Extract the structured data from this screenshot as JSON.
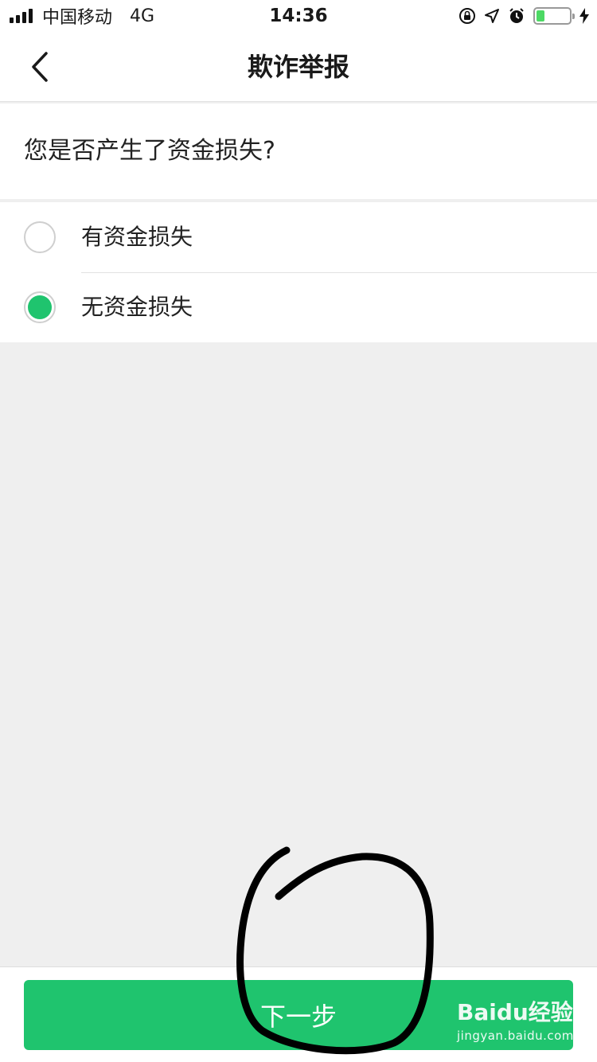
{
  "status_bar": {
    "carrier": "中国移动",
    "network": "4G",
    "time": "14:36",
    "battery_level": 0.25,
    "battery_color": "#4cd964"
  },
  "nav": {
    "title": "欺诈举报",
    "back_icon": "chevron-left-icon"
  },
  "question": {
    "text": "您是否产生了资金损失?"
  },
  "options": [
    {
      "label": "有资金损失",
      "selected": false
    },
    {
      "label": "无资金损失",
      "selected": true
    }
  ],
  "accent_color": "#1fc46e",
  "next_button": {
    "label": "下一步"
  },
  "watermark": {
    "brand": "Baidu经验",
    "url": "jingyan.baidu.com"
  }
}
